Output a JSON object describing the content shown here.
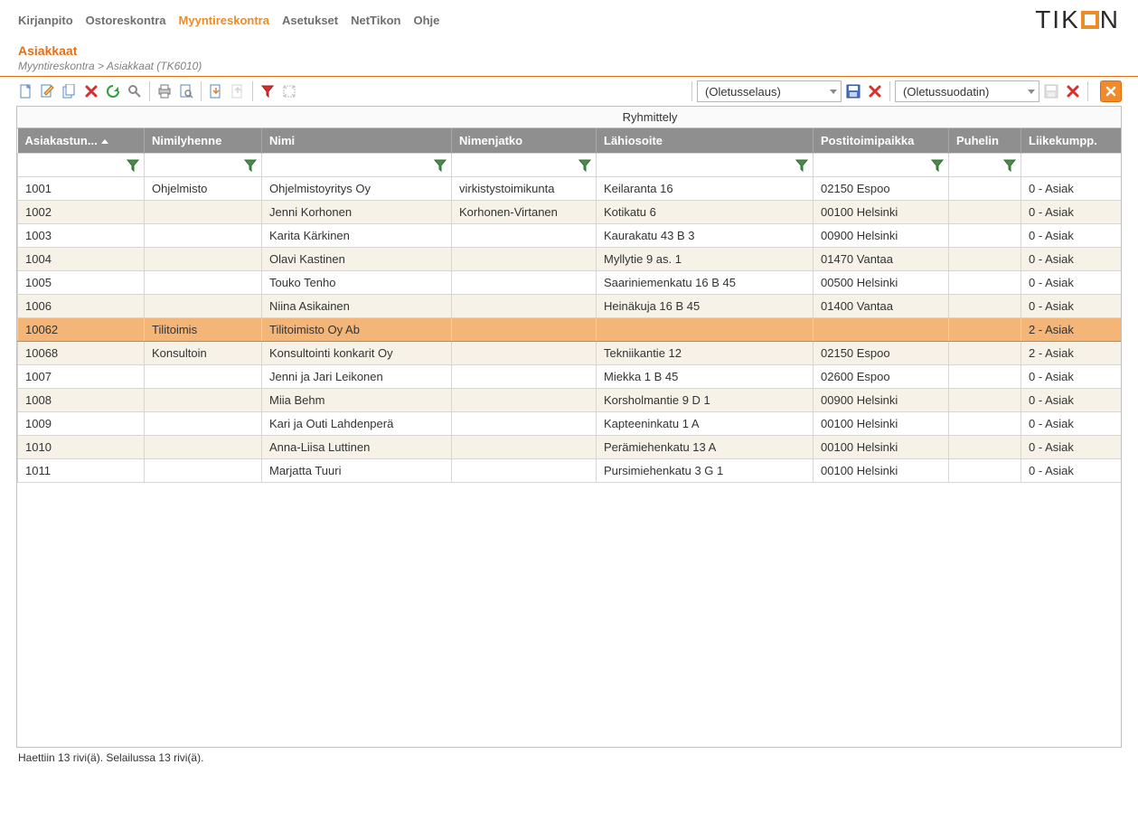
{
  "menu": {
    "items": [
      {
        "label": "Kirjanpito"
      },
      {
        "label": "Ostoreskontra"
      },
      {
        "label": "Myyntireskontra",
        "active": true
      },
      {
        "label": "Asetukset"
      },
      {
        "label": "NetTikon"
      },
      {
        "label": "Ohje"
      }
    ]
  },
  "logo_text_before": "TIK",
  "logo_text_after": "N",
  "page_title": "Asiakkaat",
  "breadcrumb": "Myyntireskontra > Asiakkaat  (TK6010)",
  "browse_combo": "(Oletusselaus)",
  "filter_combo": "(Oletussuodatin)",
  "group_header": "Ryhmittely",
  "columns": [
    "Asiakastun...",
    "Nimilyhenne",
    "Nimi",
    "Nimenjatko",
    "Lähiosoite",
    "Postitoimipaikka",
    "Puhelin",
    "Liikekumpp."
  ],
  "sorted_col_index": 0,
  "selected_row_index": 6,
  "rows": [
    {
      "c": [
        "1001",
        "Ohjelmisto",
        "Ohjelmistoyritys Oy",
        "virkistystoimikunta",
        "Keilaranta 16",
        "02150 Espoo",
        "",
        "0  -  Asiak"
      ]
    },
    {
      "c": [
        "1002",
        "",
        "Jenni Korhonen",
        "Korhonen-Virtanen",
        "Kotikatu 6",
        "00100 Helsinki",
        "",
        "0  -  Asiak"
      ]
    },
    {
      "c": [
        "1003",
        "",
        "Karita Kärkinen",
        "",
        "Kaurakatu 43 B 3",
        "00900 Helsinki",
        "",
        "0  -  Asiak"
      ]
    },
    {
      "c": [
        "1004",
        "",
        "Olavi Kastinen",
        "",
        "Myllytie 9 as. 1",
        "01470 Vantaa",
        "",
        "0  -  Asiak"
      ]
    },
    {
      "c": [
        "1005",
        "",
        "Touko Tenho",
        "",
        "Saariniemenkatu 16 B 45",
        "00500 Helsinki",
        "",
        "0  -  Asiak"
      ]
    },
    {
      "c": [
        "1006",
        "",
        "Niina Asikainen",
        "",
        "Heinäkuja 16 B 45",
        "01400 Vantaa",
        "",
        "0  -  Asiak"
      ]
    },
    {
      "c": [
        "10062",
        "Tilitoimis",
        "Tilitoimisto Oy Ab",
        "",
        "",
        "",
        "",
        "2  -  Asiak"
      ]
    },
    {
      "c": [
        "10068",
        "Konsultoin",
        "Konsultointi konkarit Oy",
        "",
        "Tekniikantie 12",
        "02150 Espoo",
        "",
        "2  -  Asiak"
      ]
    },
    {
      "c": [
        "1007",
        "",
        "Jenni ja Jari Leikonen",
        "",
        "Miekka 1 B 45",
        "02600 Espoo",
        "",
        "0  -  Asiak"
      ]
    },
    {
      "c": [
        "1008",
        "",
        "Miia Behm",
        "",
        "Korsholmantie 9 D 1",
        "00900 Helsinki",
        "",
        "0  -  Asiak"
      ]
    },
    {
      "c": [
        "1009",
        "",
        "Kari ja Outi Lahdenperä",
        "",
        "Kapteeninkatu 1 A",
        "00100 Helsinki",
        "",
        "0  -  Asiak"
      ]
    },
    {
      "c": [
        "1010",
        "",
        "Anna-Liisa Luttinen",
        "",
        "Perämiehenkatu 13 A",
        "00100 Helsinki",
        "",
        "0  -  Asiak"
      ]
    },
    {
      "c": [
        "1011",
        "",
        "Marjatta Tuuri",
        "",
        "Pursimiehenkatu 3 G 1",
        "00100 Helsinki",
        "",
        "0  -  Asiak"
      ]
    }
  ],
  "status": "Haettiin 13 rivi(ä). Selailussa 13 rivi(ä)."
}
